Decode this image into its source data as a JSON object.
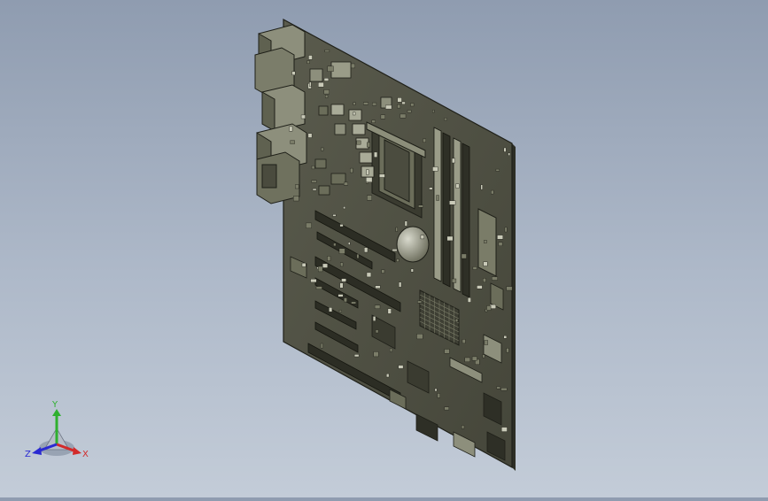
{
  "scene": {
    "board_color": "#4f5043",
    "board_edge_color": "#2a2b22",
    "component_color": "#7a7c68",
    "highlight_color": "#c9cab8"
  },
  "triad": {
    "x_label": "X",
    "y_label": "Y",
    "z_label": "Z",
    "x_color": "#d22a2a",
    "y_color": "#2fb02f",
    "z_color": "#2a2ad2"
  }
}
